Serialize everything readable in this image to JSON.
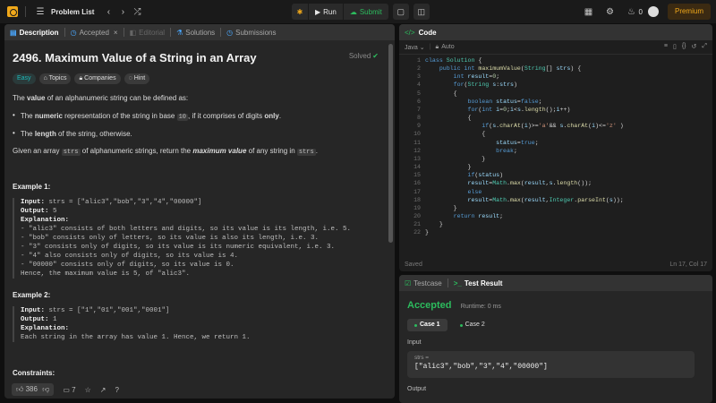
{
  "topbar": {
    "problem_list": "Problem List",
    "run": "Run",
    "submit": "Submit",
    "streak": "0",
    "premium": "Premium"
  },
  "desc_tabs": [
    "Description",
    "Accepted",
    "Editorial",
    "Solutions",
    "Submissions"
  ],
  "problem": {
    "title": "2496. Maximum Value of a String in an Array",
    "status": "Solved",
    "difficulty": "Easy",
    "chips": [
      "Topics",
      "Companies",
      "Hint"
    ],
    "intro_pre": "The ",
    "intro_bold": "value",
    "intro_post": " of an alphanumeric string can be defined as:",
    "b1_pre": "The ",
    "b1_bold": "numeric",
    "b1_mid": " representation of the string in base ",
    "b1_code": "10",
    "b1_post": ", if it comprises of digits ",
    "b1_bold2": "only",
    "b1_end": ".",
    "b2_pre": "The ",
    "b2_bold": "length",
    "b2_post": " of the string, otherwise.",
    "given_pre": "Given an array ",
    "given_code1": "strs",
    "given_mid": " of alphanumeric strings, return the ",
    "given_em": "maximum value",
    "given_post": " of any string in ",
    "given_code2": "strs",
    "given_end": ".",
    "ex1_title": "Example 1:",
    "ex1_input_k": "Input:",
    "ex1_input_v": " strs = [\"alic3\",\"bob\",\"3\",\"4\",\"00000\"]",
    "ex1_output_k": "Output:",
    "ex1_output_v": " 5",
    "ex1_expl_k": "Explanation:",
    "ex1_lines": [
      "- \"alic3\" consists of both letters and digits, so its value is its length, i.e. 5.",
      "- \"bob\" consists only of letters, so its value is also its length, i.e. 3.",
      "- \"3\" consists only of digits, so its value is its numeric equivalent, i.e. 3.",
      "- \"4\" also consists only of digits, so its value is 4.",
      "- \"00000\" consists only of digits, so its value is 0.",
      "Hence, the maximum value is 5, of \"alic3\"."
    ],
    "ex2_title": "Example 2:",
    "ex2_input_k": "Input:",
    "ex2_input_v": " strs = [\"1\",\"01\",\"001\",\"0001\"]",
    "ex2_output_k": "Output:",
    "ex2_output_v": " 1",
    "ex2_expl_k": "Explanation:",
    "ex2_line": "Each string in the array has value 1. Hence, we return 1.",
    "constraints": "Constraints:"
  },
  "desc_footer": {
    "likes": "386",
    "comments": "7"
  },
  "code_panel": {
    "title": "Code",
    "language": "Java",
    "mode": "Auto",
    "saved": "Saved",
    "cursor": "Ln 17, Col 17",
    "line_count": 22
  },
  "result_panel": {
    "tabs": [
      "Testcase",
      "Test Result"
    ],
    "verdict": "Accepted",
    "runtime": "Runtime: 0 ms",
    "cases": [
      "Case 1",
      "Case 2"
    ],
    "input_label": "Input",
    "var_name": "strs =",
    "var_value": "[\"alic3\",\"bob\",\"3\",\"4\",\"00000\"]",
    "output_label": "Output"
  },
  "colors": {
    "accepted": "#2cbb5d",
    "accent": "#f0a81a",
    "easy": "#1cbaba"
  }
}
